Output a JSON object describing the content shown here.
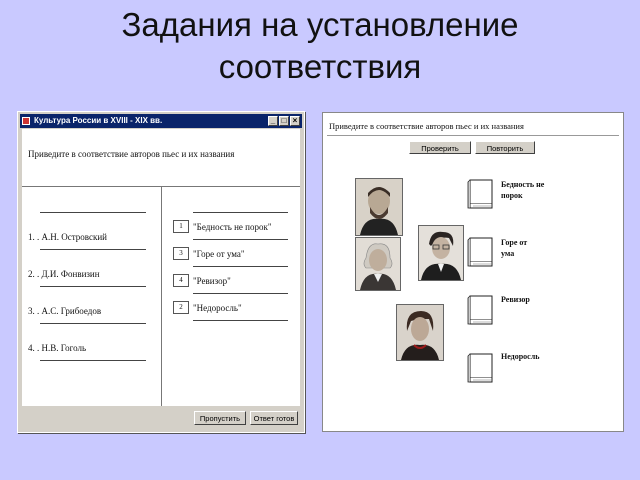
{
  "slide": {
    "title_line1": "Задания на установление",
    "title_line2": "соответствия"
  },
  "left_window": {
    "title": "Культура России в XVIII - XIX вв.",
    "instruction": "Приведите в соответствие авторов пьес и их названия",
    "authors": [
      "1. . А.Н. Островский",
      "2. . Д.И. Фонвизин",
      "3. . А.С. Грибоедов",
      "4. . Н.В. Гоголь"
    ],
    "matches": [
      {
        "number": "1",
        "play": "\"Бедность не порок\""
      },
      {
        "number": "3",
        "play": "\"Горе от ума\""
      },
      {
        "number": "4",
        "play": "\"Ревизор\""
      },
      {
        "number": "2",
        "play": "\"Недоросль\""
      }
    ],
    "buttons": {
      "skip": "Пропустить",
      "answer": "Ответ готов"
    }
  },
  "right_panel": {
    "instruction": "Приведите в соответствие авторов пьес и их названия",
    "buttons": {
      "check": "Проверить",
      "repeat": "Повторить"
    },
    "books": [
      {
        "line1": "Бедность не",
        "line2": "порок"
      },
      {
        "line1": "Горе от",
        "line2": "ума"
      },
      {
        "line1": "Ревизор",
        "line2": ""
      },
      {
        "line1": "Недоросль",
        "line2": ""
      }
    ],
    "portrait_icons": [
      "portrait-ostrovsky",
      "portrait-fonvizin",
      "portrait-griboedov",
      "portrait-gogol"
    ]
  }
}
